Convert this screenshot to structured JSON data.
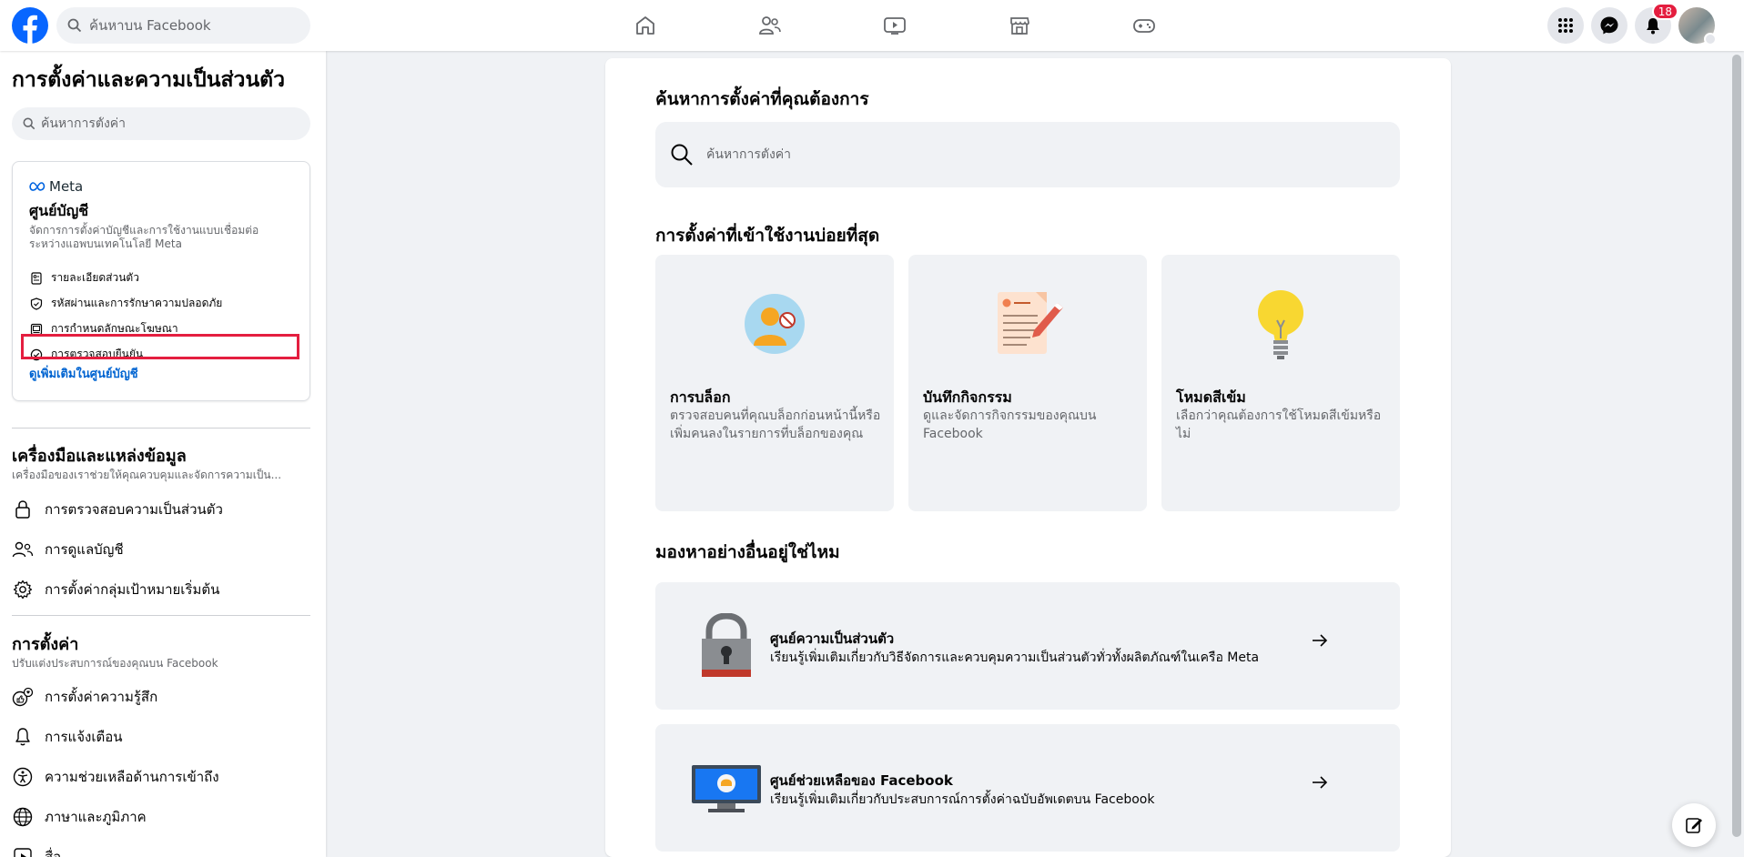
{
  "topbar": {
    "search_placeholder": "ค้นหาบน Facebook",
    "nav": [
      {
        "icon": "home-icon"
      },
      {
        "icon": "friends-icon"
      },
      {
        "icon": "video-icon"
      },
      {
        "icon": "marketplace-icon"
      },
      {
        "icon": "gaming-icon"
      }
    ],
    "notifications_count": "18",
    "colors": {
      "brand": "#0866ff",
      "badge": "#e41e3f"
    }
  },
  "sidebar": {
    "title": "การตั้งค่าและความเป็นส่วนตัว",
    "search_placeholder": "ค้นหาการตั้งค่า",
    "accounts_center": {
      "brand": "Meta",
      "title": "ศูนย์บัญชี",
      "description": "จัดการการตั้งค่าบัญชีและการใช้งานแบบเชื่อมต่อระหว่างแอพบนเทคโนโลยี Meta",
      "items": [
        {
          "label": "รายละเอียดส่วนตัว",
          "icon": "id-card-icon"
        },
        {
          "label": "รหัสผ่านและการรักษาความปลอดภัย",
          "icon": "shield-icon"
        },
        {
          "label": "การกำหนดลักษณะโฆษณา",
          "icon": "ad-preferences-icon"
        },
        {
          "label": "การตรวจสอบยืนยัน",
          "icon": "verified-icon"
        }
      ],
      "more_link": "ดูเพิ่มเติมในศูนย์บัญชี"
    },
    "tools": {
      "title": "เครื่องมือและแหล่งข้อมูล",
      "description": "เครื่องมือของเราช่วยให้คุณควบคุมและจัดการความเป็น...",
      "items": [
        {
          "label": "การตรวจสอบความเป็นส่วนตัว",
          "icon": "lock-icon"
        },
        {
          "label": "การดูแลบัญชี",
          "icon": "supervision-icon"
        },
        {
          "label": "การตั้งค่ากลุ่มเป้าหมายเริ่มต้น",
          "icon": "gear-icon"
        }
      ]
    },
    "settings": {
      "title": "การตั้งค่า",
      "description": "ปรับแต่งประสบการณ์ของคุณบน Facebook",
      "items": [
        {
          "label": "การตั้งค่าความรู้สึก",
          "icon": "reaction-icon"
        },
        {
          "label": "การแจ้งเตือน",
          "icon": "bell-icon"
        },
        {
          "label": "ความช่วยเหลือด้านการเข้าถึง",
          "icon": "accessibility-icon"
        },
        {
          "label": "ภาษาและภูมิภาค",
          "icon": "globe-icon"
        },
        {
          "label": "สื่อ",
          "icon": "media-icon"
        }
      ]
    }
  },
  "main": {
    "search_heading": "ค้นหาการตั้งค่าที่คุณต้องการ",
    "search_placeholder": "ค้นหาการตั้งค่า",
    "frequent_heading": "การตั้งค่าที่เข้าใช้งานบ่อยที่สุด",
    "cards": [
      {
        "title": "การบล็อก",
        "description": "ตรวจสอบคนที่คุณบล็อกก่อนหน้านี้หรือเพิ่มคนลงในรายการที่บล็อกของคุณ",
        "icon": "blocking-icon"
      },
      {
        "title": "บันทึกกิจกรรม",
        "description": "ดูและจัดการกิจกรรมของคุณบน Facebook",
        "icon": "activity-log-icon"
      },
      {
        "title": "โหมดสีเข้ม",
        "description": "เลือกว่าคุณต้องการใช้โหมดสีเข้มหรือไม่",
        "icon": "lightbulb-icon"
      }
    ],
    "other_heading": "มองหาอย่างอื่นอยู่ใช่ไหม",
    "links": [
      {
        "title": "ศูนย์ความเป็นส่วนตัว",
        "description": "เรียนรู้เพิ่มเติมเกี่ยวกับวิธีจัดการและควบคุมความเป็นส่วนตัวทั่วทั้งผลิตภัณฑ์ในเครือ Meta",
        "icon": "privacy-center-icon"
      },
      {
        "title": "ศูนย์ช่วยเหลือของ Facebook",
        "description": "เรียนรู้เพิ่มเติมเกี่ยวกับประสบการณ์การตั้งค่าฉบับอัพเดตบน Facebook",
        "icon": "help-center-icon"
      }
    ]
  }
}
